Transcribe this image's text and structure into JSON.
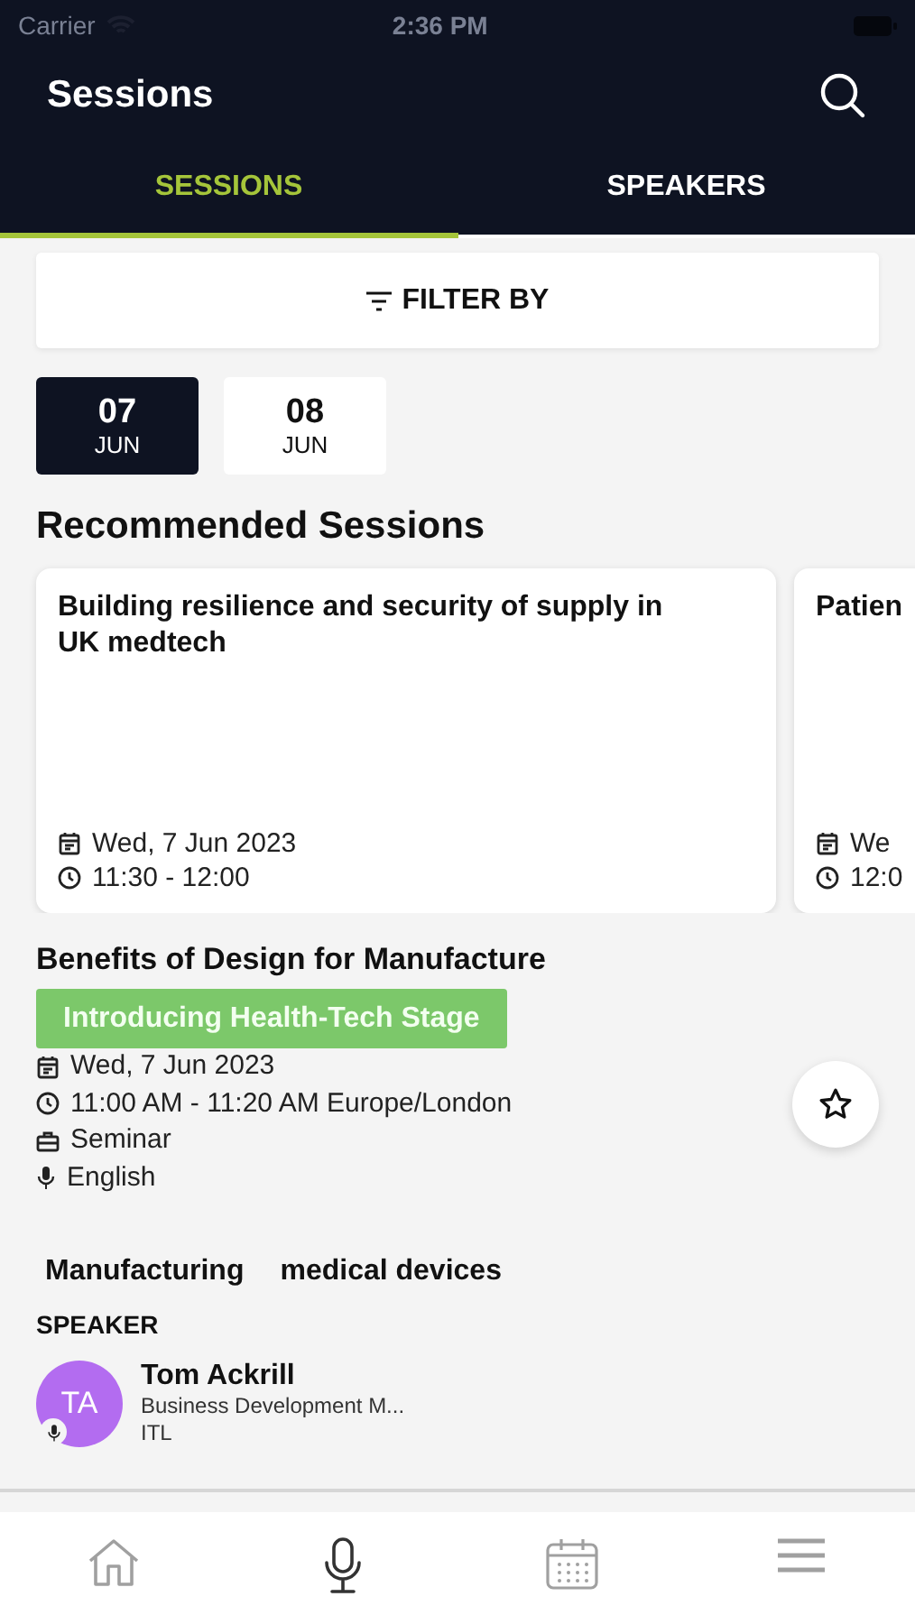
{
  "status_bar": {
    "carrier": "Carrier",
    "time": "2:36 PM"
  },
  "header": {
    "title": "Sessions"
  },
  "tabs": [
    {
      "label": "SESSIONS",
      "selected": true
    },
    {
      "label": "SPEAKERS",
      "selected": false
    }
  ],
  "filter": {
    "label": "FILTER BY"
  },
  "dates": [
    {
      "day": "07",
      "month": "JUN",
      "selected": true
    },
    {
      "day": "08",
      "month": "JUN",
      "selected": false
    }
  ],
  "recommended": {
    "heading": "Recommended Sessions",
    "cards": [
      {
        "title": "Building resilience and security of supply in UK medtech",
        "date": "Wed, 7 Jun 2023",
        "time": "11:30 - 12:00"
      },
      {
        "title": "Patien",
        "date": "We",
        "time": "12:0"
      }
    ]
  },
  "session": {
    "title": "Benefits of Design for Manufacture",
    "stage": "Introducing Health-Tech Stage",
    "date": "Wed, 7 Jun 2023",
    "time": "11:00 AM - 11:20 AM Europe/London",
    "type": "Seminar",
    "language": "English",
    "favorite": false,
    "topics": [
      "Manufacturing",
      "medical devices"
    ],
    "speaker_heading": "SPEAKER",
    "speakers": [
      {
        "initials": "TA",
        "name": "Tom Ackrill",
        "role": "Business Development M...",
        "company": "ITL",
        "color": "#b36cf0"
      }
    ]
  },
  "nav": [
    {
      "kind": "home",
      "selected": false
    },
    {
      "kind": "speakers",
      "selected": true
    },
    {
      "kind": "agenda",
      "selected": false
    },
    {
      "kind": "menu",
      "selected": false
    }
  ]
}
